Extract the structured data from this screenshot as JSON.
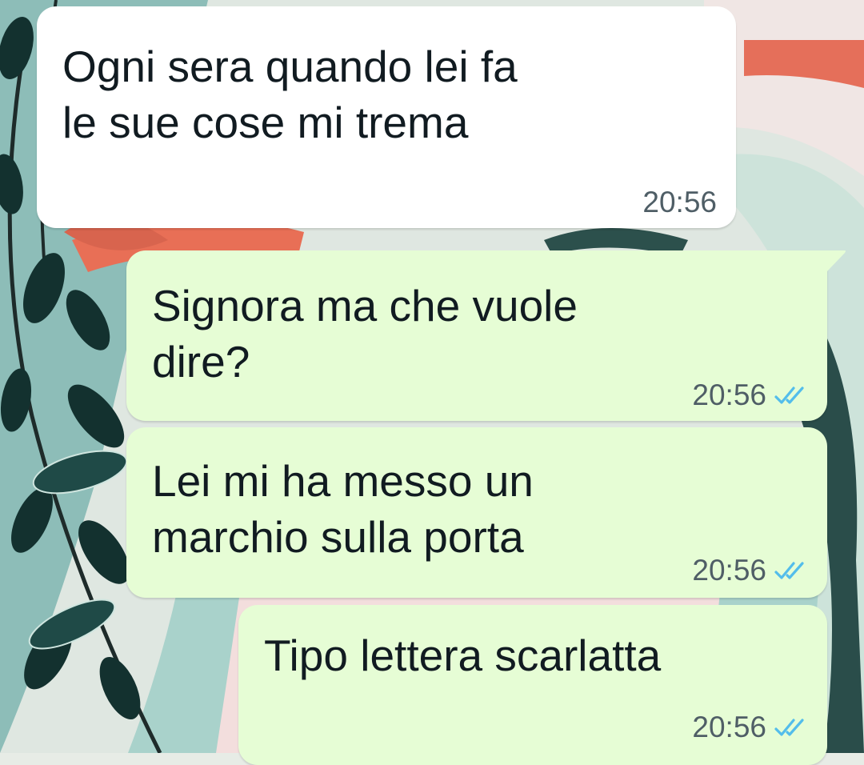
{
  "messages": [
    {
      "direction": "incoming",
      "lines": [
        "Ogni sera quando lei fa",
        "le sue cose mi trema"
      ],
      "time": "20:56"
    },
    {
      "direction": "outgoing",
      "lines": [
        "Signora ma che vuole",
        "dire?"
      ],
      "time": "20:56",
      "status_icon": "double-check-icon"
    },
    {
      "direction": "outgoing",
      "lines": [
        "Lei mi ha messo un",
        "marchio sulla porta"
      ],
      "time": "20:56",
      "status_icon": "double-check-icon"
    },
    {
      "direction": "outgoing",
      "lines": [
        "Tipo lettera scarlatta"
      ],
      "time": "20:56",
      "status_icon": "double-check-icon"
    }
  ],
  "colors": {
    "incoming_bubble": "#ffffff",
    "outgoing_bubble": "#e6fdd5",
    "read_ticks": "#53bdeb",
    "text": "#111b21",
    "timestamp": "#4f5e66"
  }
}
